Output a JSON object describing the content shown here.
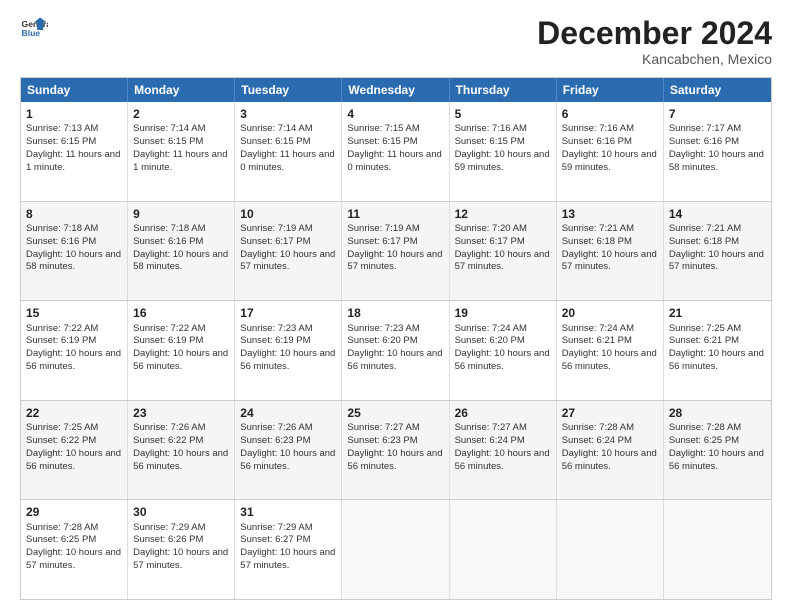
{
  "logo": {
    "line1": "General",
    "line2": "Blue"
  },
  "title": "December 2024",
  "location": "Kancabchen, Mexico",
  "days_of_week": [
    "Sunday",
    "Monday",
    "Tuesday",
    "Wednesday",
    "Thursday",
    "Friday",
    "Saturday"
  ],
  "weeks": [
    [
      {
        "day": "1",
        "info": "Sunrise: 7:13 AM\nSunset: 6:15 PM\nDaylight: 11 hours and 1 minute."
      },
      {
        "day": "2",
        "info": "Sunrise: 7:14 AM\nSunset: 6:15 PM\nDaylight: 11 hours and 1 minute."
      },
      {
        "day": "3",
        "info": "Sunrise: 7:14 AM\nSunset: 6:15 PM\nDaylight: 11 hours and 0 minutes."
      },
      {
        "day": "4",
        "info": "Sunrise: 7:15 AM\nSunset: 6:15 PM\nDaylight: 11 hours and 0 minutes."
      },
      {
        "day": "5",
        "info": "Sunrise: 7:16 AM\nSunset: 6:15 PM\nDaylight: 10 hours and 59 minutes."
      },
      {
        "day": "6",
        "info": "Sunrise: 7:16 AM\nSunset: 6:16 PM\nDaylight: 10 hours and 59 minutes."
      },
      {
        "day": "7",
        "info": "Sunrise: 7:17 AM\nSunset: 6:16 PM\nDaylight: 10 hours and 58 minutes."
      }
    ],
    [
      {
        "day": "8",
        "info": "Sunrise: 7:18 AM\nSunset: 6:16 PM\nDaylight: 10 hours and 58 minutes."
      },
      {
        "day": "9",
        "info": "Sunrise: 7:18 AM\nSunset: 6:16 PM\nDaylight: 10 hours and 58 minutes."
      },
      {
        "day": "10",
        "info": "Sunrise: 7:19 AM\nSunset: 6:17 PM\nDaylight: 10 hours and 57 minutes."
      },
      {
        "day": "11",
        "info": "Sunrise: 7:19 AM\nSunset: 6:17 PM\nDaylight: 10 hours and 57 minutes."
      },
      {
        "day": "12",
        "info": "Sunrise: 7:20 AM\nSunset: 6:17 PM\nDaylight: 10 hours and 57 minutes."
      },
      {
        "day": "13",
        "info": "Sunrise: 7:21 AM\nSunset: 6:18 PM\nDaylight: 10 hours and 57 minutes."
      },
      {
        "day": "14",
        "info": "Sunrise: 7:21 AM\nSunset: 6:18 PM\nDaylight: 10 hours and 57 minutes."
      }
    ],
    [
      {
        "day": "15",
        "info": "Sunrise: 7:22 AM\nSunset: 6:19 PM\nDaylight: 10 hours and 56 minutes."
      },
      {
        "day": "16",
        "info": "Sunrise: 7:22 AM\nSunset: 6:19 PM\nDaylight: 10 hours and 56 minutes."
      },
      {
        "day": "17",
        "info": "Sunrise: 7:23 AM\nSunset: 6:19 PM\nDaylight: 10 hours and 56 minutes."
      },
      {
        "day": "18",
        "info": "Sunrise: 7:23 AM\nSunset: 6:20 PM\nDaylight: 10 hours and 56 minutes."
      },
      {
        "day": "19",
        "info": "Sunrise: 7:24 AM\nSunset: 6:20 PM\nDaylight: 10 hours and 56 minutes."
      },
      {
        "day": "20",
        "info": "Sunrise: 7:24 AM\nSunset: 6:21 PM\nDaylight: 10 hours and 56 minutes."
      },
      {
        "day": "21",
        "info": "Sunrise: 7:25 AM\nSunset: 6:21 PM\nDaylight: 10 hours and 56 minutes."
      }
    ],
    [
      {
        "day": "22",
        "info": "Sunrise: 7:25 AM\nSunset: 6:22 PM\nDaylight: 10 hours and 56 minutes."
      },
      {
        "day": "23",
        "info": "Sunrise: 7:26 AM\nSunset: 6:22 PM\nDaylight: 10 hours and 56 minutes."
      },
      {
        "day": "24",
        "info": "Sunrise: 7:26 AM\nSunset: 6:23 PM\nDaylight: 10 hours and 56 minutes."
      },
      {
        "day": "25",
        "info": "Sunrise: 7:27 AM\nSunset: 6:23 PM\nDaylight: 10 hours and 56 minutes."
      },
      {
        "day": "26",
        "info": "Sunrise: 7:27 AM\nSunset: 6:24 PM\nDaylight: 10 hours and 56 minutes."
      },
      {
        "day": "27",
        "info": "Sunrise: 7:28 AM\nSunset: 6:24 PM\nDaylight: 10 hours and 56 minutes."
      },
      {
        "day": "28",
        "info": "Sunrise: 7:28 AM\nSunset: 6:25 PM\nDaylight: 10 hours and 56 minutes."
      }
    ],
    [
      {
        "day": "29",
        "info": "Sunrise: 7:28 AM\nSunset: 6:25 PM\nDaylight: 10 hours and 57 minutes."
      },
      {
        "day": "30",
        "info": "Sunrise: 7:29 AM\nSunset: 6:26 PM\nDaylight: 10 hours and 57 minutes."
      },
      {
        "day": "31",
        "info": "Sunrise: 7:29 AM\nSunset: 6:27 PM\nDaylight: 10 hours and 57 minutes."
      },
      {
        "day": "",
        "info": ""
      },
      {
        "day": "",
        "info": ""
      },
      {
        "day": "",
        "info": ""
      },
      {
        "day": "",
        "info": ""
      }
    ]
  ]
}
